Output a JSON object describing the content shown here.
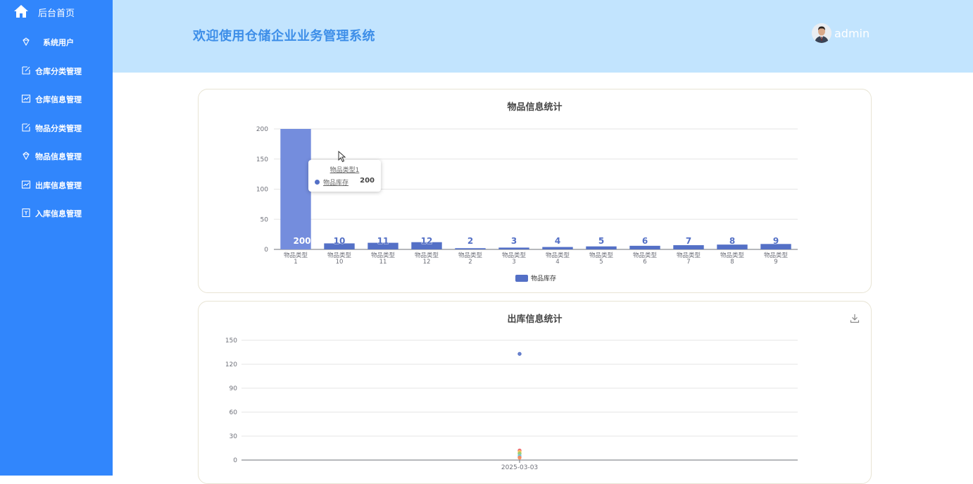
{
  "sidebar": {
    "home": {
      "label": "后台首页",
      "icon": "home-icon"
    },
    "items": [
      {
        "label": "系统用户",
        "icon": "diamond-icon",
        "name": "sidebar-item-system-users"
      },
      {
        "label": "仓库分类管理",
        "icon": "edit-icon",
        "name": "sidebar-item-warehouse-category"
      },
      {
        "label": "仓库信息管理",
        "icon": "chart-line-icon",
        "name": "sidebar-item-warehouse-info"
      },
      {
        "label": "物品分类管理",
        "icon": "edit-icon",
        "name": "sidebar-item-item-category"
      },
      {
        "label": "物品信息管理",
        "icon": "diamond-icon",
        "name": "sidebar-item-item-info"
      },
      {
        "label": "出库信息管理",
        "icon": "chart-line-icon",
        "name": "sidebar-item-outbound-info"
      },
      {
        "label": "入库信息管理",
        "icon": "badge-icon",
        "name": "sidebar-item-inbound-info"
      }
    ],
    "colors": {
      "background": "#3186fc"
    }
  },
  "header": {
    "title": "欢迎使用仓储企业业务管理系统",
    "username": "admin",
    "colors": {
      "background": "#c2e4fe",
      "title": "#3d8ee8"
    }
  },
  "chart_data": [
    {
      "type": "bar",
      "title": "物品信息统计",
      "categories": [
        "物品类型1",
        "物品类型10",
        "物品类型11",
        "物品类型12",
        "物品类型2",
        "物品类型3",
        "物品类型4",
        "物品类型5",
        "物品类型6",
        "物品类型7",
        "物品类型8",
        "物品类型9"
      ],
      "series": [
        {
          "name": "物品库存",
          "values": [
            200,
            10,
            11,
            12,
            2,
            3,
            4,
            5,
            6,
            7,
            8,
            9
          ],
          "color": "#5470c6"
        }
      ],
      "ylim": [
        0,
        200
      ],
      "yticks": [
        0,
        50,
        100,
        150,
        200
      ],
      "grid": true,
      "legend": "bottom-center",
      "tooltip": {
        "title": "物品类型1",
        "series": "物品库存",
        "value": "200"
      },
      "highlight_color": "#748ddd"
    },
    {
      "type": "scatter",
      "title": "出库信息统计",
      "x": [
        "2025-03-03"
      ],
      "series": [
        {
          "values": [
            133
          ],
          "color": "#5470c6"
        },
        {
          "values": [
            12
          ],
          "color": "#ee6666"
        },
        {
          "values": [
            10
          ],
          "color": "#fac858"
        },
        {
          "values": [
            8
          ],
          "color": "#91cc75"
        },
        {
          "values": [
            5
          ],
          "color": "#73c0de"
        },
        {
          "values": [
            3
          ],
          "color": "#fc8452"
        }
      ],
      "ylim": [
        0,
        150
      ],
      "yticks": [
        0,
        30,
        60,
        90,
        120,
        150
      ],
      "grid": true,
      "toolbox": "download-icon"
    }
  ]
}
